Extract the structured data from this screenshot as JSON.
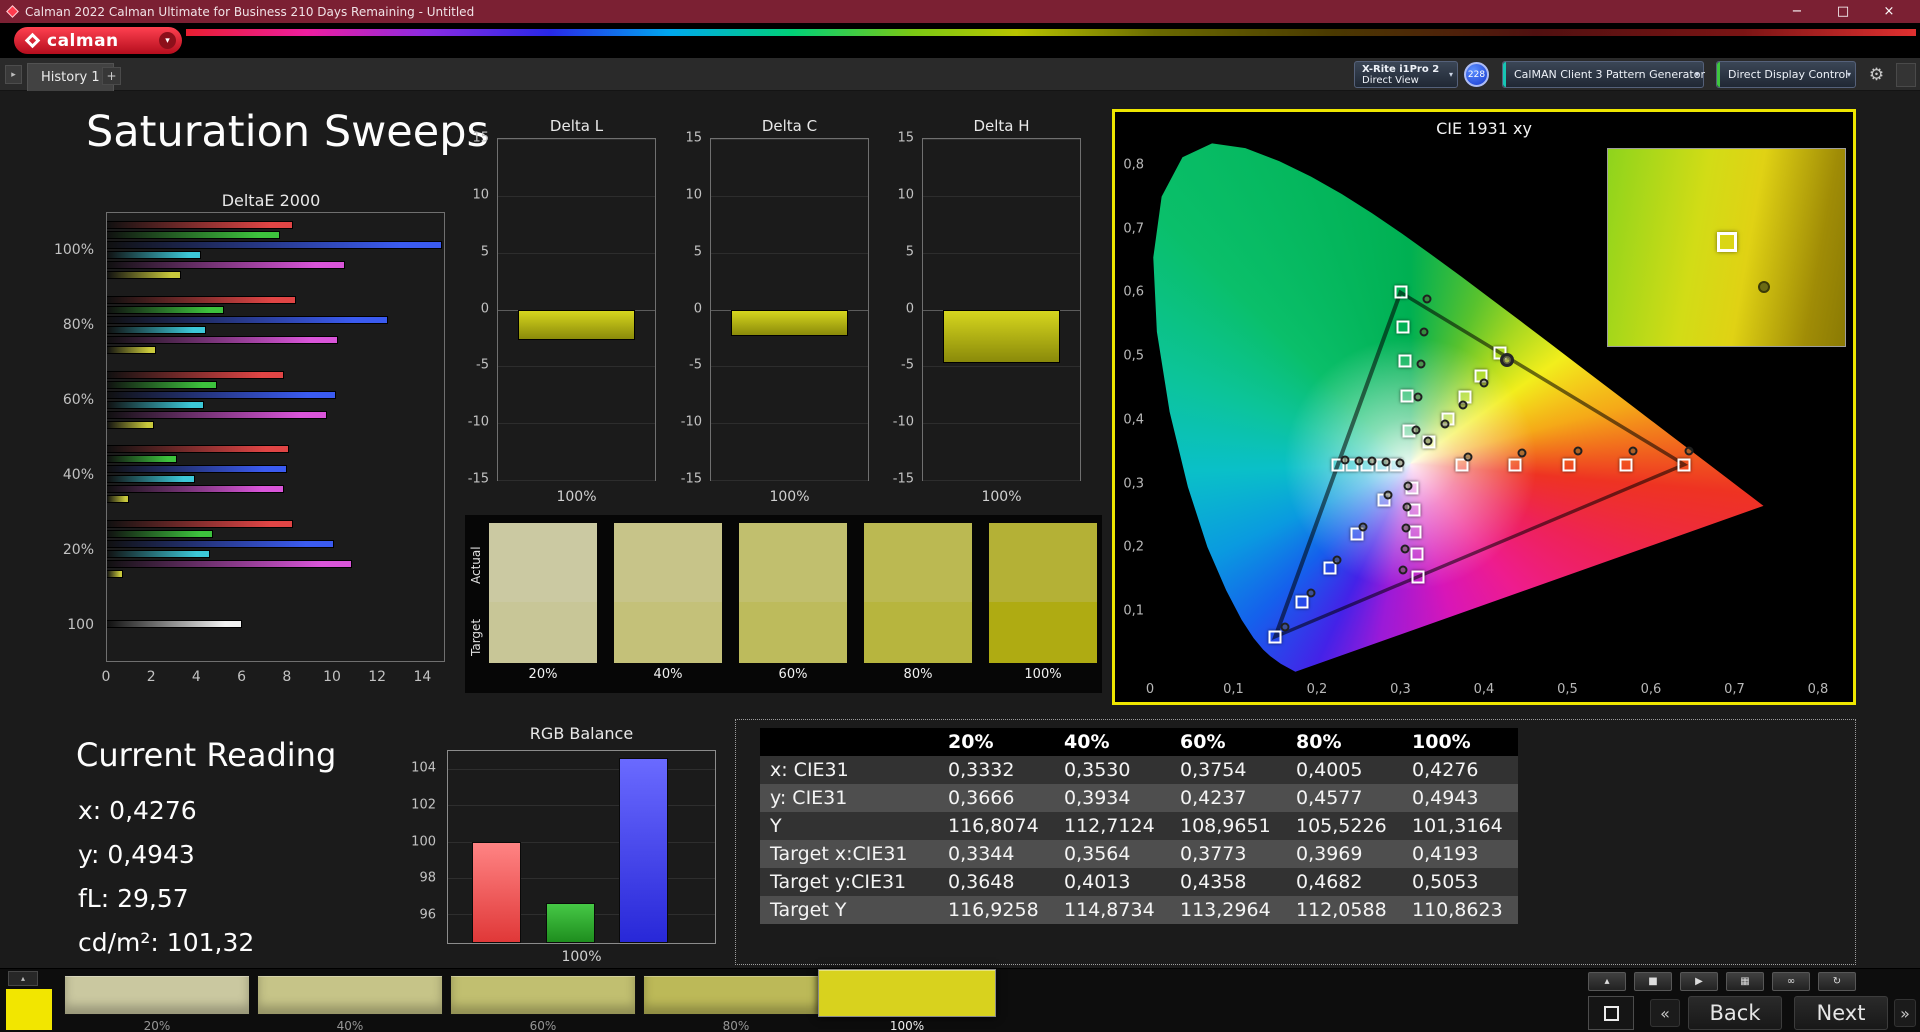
{
  "window": {
    "title": "Calman 2022 Calman Ultimate for Business 210 Days Remaining  - Untitled",
    "controls": {
      "minimize": "−",
      "maximize": "□",
      "close": "×"
    }
  },
  "brand": {
    "logo_text": "calman"
  },
  "icons": {
    "dropdown_arrow": "▾",
    "gear": "⚙",
    "tab_scroll": "▸",
    "up_arrow": "▴",
    "double_left": "«",
    "double_right": "»"
  },
  "tab_bar": {
    "history_tab": "History 1",
    "add_tab": "+"
  },
  "toolbar": {
    "meter": {
      "line1": "X-Rite i1Pro 2",
      "line2": "Direct View"
    },
    "badge": "228",
    "pattern_generator": "CalMAN Client 3 Pattern Generator",
    "display_control": "Direct Display Control",
    "pattern_accent": "#17c6b4",
    "display_accent": "#3ec63e"
  },
  "page": {
    "title": "Saturation Sweeps"
  },
  "deltae_chart": {
    "title": "DeltaE 2000",
    "x_ticks": [
      0,
      2,
      4,
      6,
      8,
      10,
      12,
      14
    ],
    "x_max": 15,
    "series_colors": [
      "#e04545",
      "#3dc23d",
      "#3b5bf0",
      "#3cc8d8",
      "#d955d9",
      "#c8c83c"
    ],
    "white_color": "#f2f2f2",
    "groups": [
      {
        "label": "100%",
        "values": [
          8.3,
          7.7,
          14.9,
          4.2,
          10.6,
          3.3
        ]
      },
      {
        "label": "80%",
        "values": [
          8.4,
          5.2,
          12.5,
          4.4,
          10.3,
          2.2
        ]
      },
      {
        "label": "60%",
        "values": [
          7.9,
          4.9,
          10.2,
          4.3,
          9.8,
          2.1
        ]
      },
      {
        "label": "40%",
        "values": [
          8.1,
          3.1,
          8.0,
          3.9,
          7.9,
          1.0
        ]
      },
      {
        "label": "20%",
        "values": [
          8.3,
          4.7,
          10.1,
          4.6,
          10.9,
          0.7
        ]
      },
      {
        "label": "100",
        "values": [
          6.0
        ],
        "white": true
      }
    ]
  },
  "delta_axis": {
    "ticks": [
      15,
      10,
      5,
      0,
      -5,
      -10,
      -15
    ]
  },
  "delta_charts": [
    {
      "title": "Delta L",
      "value": -2.7,
      "x_label": "100%",
      "bar_color": "#d6d61e"
    },
    {
      "title": "Delta C",
      "value": -2.3,
      "x_label": "100%",
      "bar_color": "#d6d61e"
    },
    {
      "title": "Delta H",
      "value": -4.7,
      "x_label": "100%",
      "bar_color": "#d6d61e"
    }
  ],
  "swatches": {
    "row_labels": [
      "Actual",
      "Target"
    ],
    "items": [
      {
        "label": "20%",
        "actual": "#cbc9a2",
        "target": "#c8c697"
      },
      {
        "label": "40%",
        "actual": "#c7c489",
        "target": "#c4c179"
      },
      {
        "label": "60%",
        "actual": "#c1bf6e",
        "target": "#bdbb5c"
      },
      {
        "label": "80%",
        "actual": "#bbb952",
        "target": "#b7b53e"
      },
      {
        "label": "100%",
        "actual": "#b4b136",
        "target": "#afab12"
      }
    ]
  },
  "cie_chart": {
    "title": "CIE 1931 xy",
    "border_color": "#eee600",
    "x_ticks": [
      "0",
      "0,1",
      "0,2",
      "0,3",
      "0,4",
      "0,5",
      "0,6",
      "0,7",
      "0,8"
    ],
    "y_ticks": [
      "0,1",
      "0,2",
      "0,3",
      "0,4",
      "0,5",
      "0,6",
      "0,7",
      "0,8"
    ],
    "x_max": 0.8,
    "y_max": 0.85,
    "gamut_triangle": [
      [
        0.64,
        0.33
      ],
      [
        0.3,
        0.6
      ],
      [
        0.15,
        0.06
      ]
    ],
    "spectral_locus": [
      [
        0.1741,
        0.005
      ],
      [
        0.1566,
        0.0177
      ],
      [
        0.144,
        0.0297
      ],
      [
        0.1355,
        0.0399
      ],
      [
        0.1241,
        0.0578
      ],
      [
        0.1096,
        0.0868
      ],
      [
        0.0913,
        0.1327
      ],
      [
        0.0687,
        0.2007
      ],
      [
        0.0454,
        0.295
      ],
      [
        0.0235,
        0.4127
      ],
      [
        0.0082,
        0.5384
      ],
      [
        0.0039,
        0.6548
      ],
      [
        0.0139,
        0.7502
      ],
      [
        0.0389,
        0.812
      ],
      [
        0.0743,
        0.8338
      ],
      [
        0.1142,
        0.8262
      ],
      [
        0.1547,
        0.8059
      ],
      [
        0.1929,
        0.7816
      ],
      [
        0.2296,
        0.7543
      ],
      [
        0.2658,
        0.7243
      ],
      [
        0.3016,
        0.6923
      ],
      [
        0.3373,
        0.6589
      ],
      [
        0.3731,
        0.6245
      ],
      [
        0.4087,
        0.5896
      ],
      [
        0.4441,
        0.5547
      ],
      [
        0.4788,
        0.5202
      ],
      [
        0.5125,
        0.4866
      ],
      [
        0.5448,
        0.4544
      ],
      [
        0.5752,
        0.4242
      ],
      [
        0.6029,
        0.3965
      ],
      [
        0.627,
        0.3725
      ],
      [
        0.6482,
        0.3514
      ],
      [
        0.6658,
        0.334
      ],
      [
        0.6915,
        0.3083
      ],
      [
        0.7079,
        0.292
      ],
      [
        0.719,
        0.2809
      ],
      [
        0.7347,
        0.2653
      ]
    ],
    "targets": [
      [
        0.3742,
        0.3292
      ],
      [
        0.4372,
        0.3295
      ],
      [
        0.5012,
        0.3297
      ],
      [
        0.5706,
        0.3299
      ],
      [
        0.64,
        0.33
      ],
      [
        0.31,
        0.383
      ],
      [
        0.3075,
        0.4375
      ],
      [
        0.305,
        0.4917
      ],
      [
        0.3025,
        0.546
      ],
      [
        0.3,
        0.6
      ],
      [
        0.2802,
        0.2752
      ],
      [
        0.2476,
        0.2214
      ],
      [
        0.215,
        0.1676
      ],
      [
        0.1825,
        0.1138
      ],
      [
        0.15,
        0.06
      ],
      [
        0.295,
        0.329
      ],
      [
        0.2774,
        0.3289
      ],
      [
        0.2598,
        0.3289
      ],
      [
        0.2422,
        0.3288
      ],
      [
        0.2246,
        0.3287
      ],
      [
        0.3143,
        0.294
      ],
      [
        0.316,
        0.2591
      ],
      [
        0.3176,
        0.2241
      ],
      [
        0.3193,
        0.1892
      ],
      [
        0.3209,
        0.1542
      ],
      [
        0.3344,
        0.3648
      ],
      [
        0.3564,
        0.4013
      ],
      [
        0.3773,
        0.4358
      ],
      [
        0.3969,
        0.4682
      ],
      [
        0.4193,
        0.5053
      ]
    ],
    "measurements": [
      [
        0.381,
        0.342
      ],
      [
        0.446,
        0.348
      ],
      [
        0.512,
        0.351
      ],
      [
        0.578,
        0.352
      ],
      [
        0.645,
        0.352
      ],
      [
        0.318,
        0.385
      ],
      [
        0.321,
        0.436
      ],
      [
        0.324,
        0.487
      ],
      [
        0.328,
        0.538
      ],
      [
        0.332,
        0.59
      ],
      [
        0.285,
        0.283
      ],
      [
        0.255,
        0.232
      ],
      [
        0.224,
        0.18
      ],
      [
        0.193,
        0.128
      ],
      [
        0.162,
        0.075
      ],
      [
        0.299,
        0.333
      ],
      [
        0.283,
        0.334
      ],
      [
        0.266,
        0.335
      ],
      [
        0.25,
        0.336
      ],
      [
        0.234,
        0.337
      ],
      [
        0.309,
        0.296
      ],
      [
        0.308,
        0.263
      ],
      [
        0.306,
        0.23
      ],
      [
        0.305,
        0.197
      ],
      [
        0.303,
        0.164
      ],
      [
        0.3332,
        0.3666
      ],
      [
        0.353,
        0.3934
      ],
      [
        0.3754,
        0.4237
      ],
      [
        0.4005,
        0.4577
      ],
      [
        0.4276,
        0.4943
      ]
    ],
    "current": [
      0.4276,
      0.4943
    ]
  },
  "current_reading": {
    "title": "Current Reading",
    "lines": [
      "x: 0,4276",
      "y: 0,4943",
      "fL: 29,57",
      "cd/m²: 101,32"
    ]
  },
  "rgb_balance": {
    "title": "RGB Balance",
    "y_ticks": [
      104,
      102,
      100,
      98,
      96
    ],
    "y_min": 94.4,
    "y_max": 105.0,
    "x_label": "100%",
    "bars": [
      {
        "name": "red",
        "value": 100.0,
        "color": "#e03838",
        "highlight": "#ff8484"
      },
      {
        "name": "green",
        "value": 96.6,
        "color": "#1e8e1e",
        "highlight": "#46c846"
      },
      {
        "name": "blue",
        "value": 104.6,
        "color": "#2828d8",
        "highlight": "#6a6aff"
      }
    ]
  },
  "table": {
    "columns": [
      "",
      "20%",
      "40%",
      "60%",
      "80%",
      "100%"
    ],
    "rows": [
      {
        "label": "x: CIE31",
        "values": [
          "0,3332",
          "0,3530",
          "0,3754",
          "0,4005",
          "0,4276"
        ]
      },
      {
        "label": "y: CIE31",
        "values": [
          "0,3666",
          "0,3934",
          "0,4237",
          "0,4577",
          "0,4943"
        ]
      },
      {
        "label": "Y",
        "values": [
          "116,8074",
          "112,7124",
          "108,9651",
          "105,5226",
          "101,3164"
        ]
      },
      {
        "label": "Target x:CIE31",
        "values": [
          "0,3344",
          "0,3564",
          "0,3773",
          "0,3969",
          "0,4193"
        ]
      },
      {
        "label": "Target y:CIE31",
        "values": [
          "0,3648",
          "0,4013",
          "0,4358",
          "0,4682",
          "0,5053"
        ]
      },
      {
        "label": "Target Y",
        "values": [
          "116,9258",
          "114,8734",
          "113,2964",
          "112,0588",
          "110,8623"
        ]
      }
    ]
  },
  "bottom_bar": {
    "active_color": "#f2e600",
    "swatches": [
      {
        "label": "20%",
        "color": "#cac8a0"
      },
      {
        "label": "40%",
        "color": "#c6c488"
      },
      {
        "label": "60%",
        "color": "#c1bf70"
      },
      {
        "label": "80%",
        "color": "#bcb958"
      },
      {
        "label": "100%",
        "color": "#d8d21e",
        "selected": true
      }
    ],
    "transport": [
      {
        "name": "eject-button",
        "glyph": "▴"
      },
      {
        "name": "stop-button",
        "glyph": "■"
      },
      {
        "name": "play-button",
        "glyph": "▶"
      },
      {
        "name": "pattern-grid-button",
        "glyph": "▦"
      },
      {
        "name": "loop-button",
        "glyph": "∞"
      },
      {
        "name": "repeat-button",
        "glyph": "↻"
      }
    ],
    "back_label": "Back",
    "next_label": "Next"
  }
}
